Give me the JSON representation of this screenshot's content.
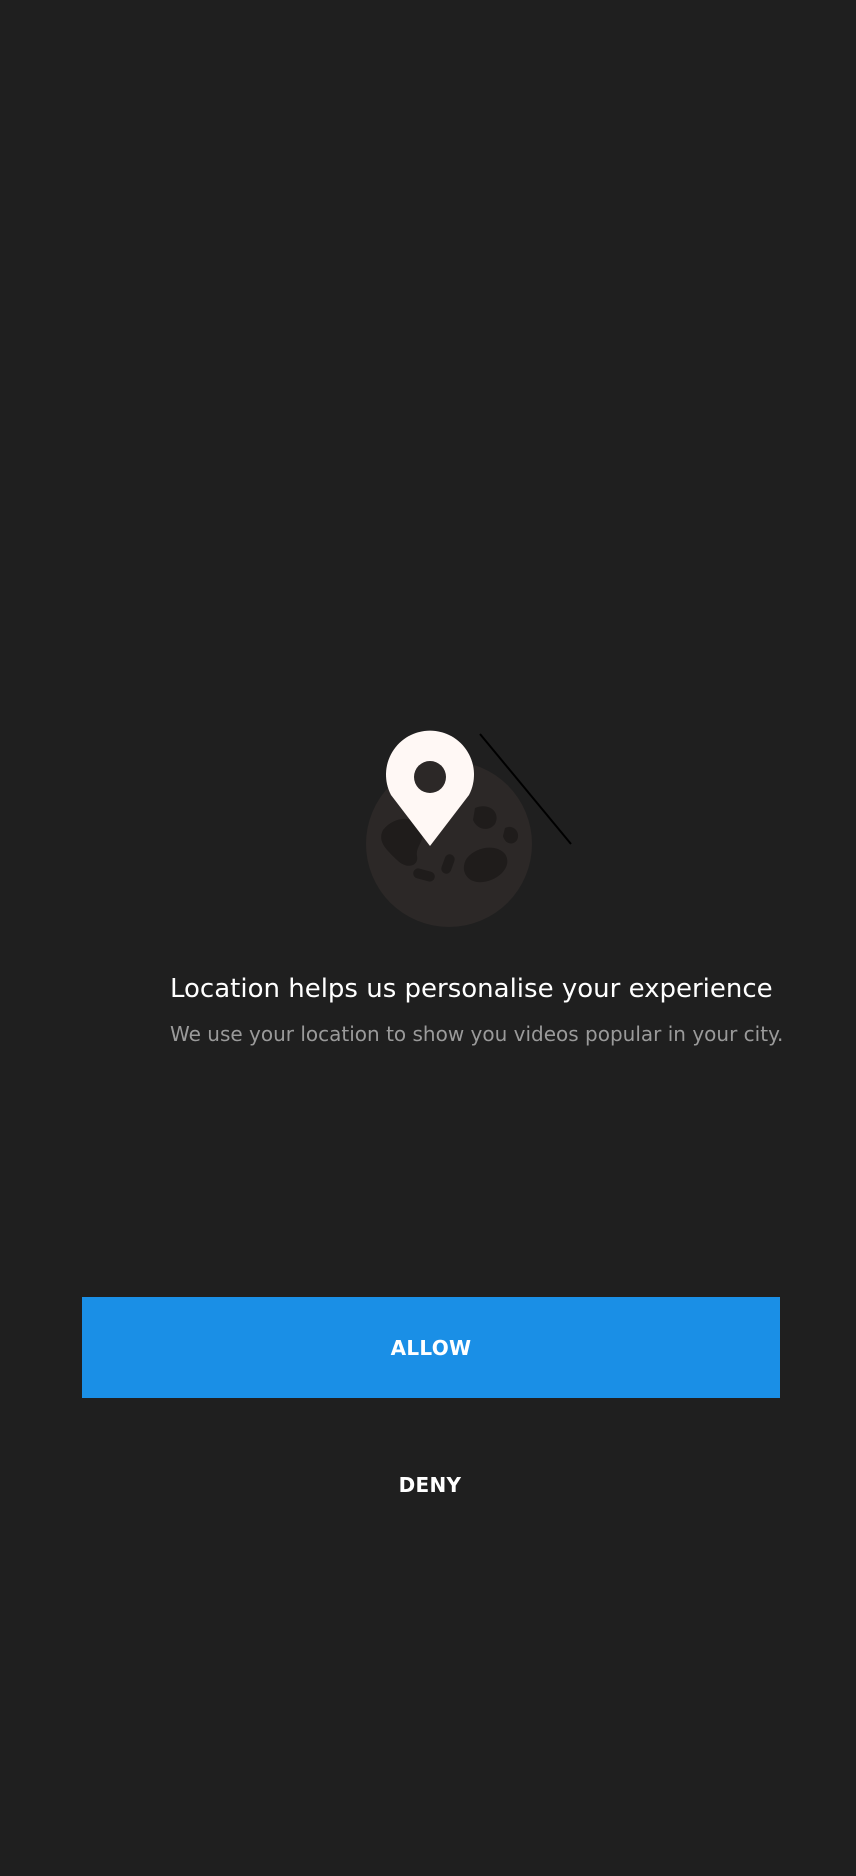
{
  "permission": {
    "title": "Location helps us personalise your experience",
    "subtitle": "We use your location to show you videos popular in your city.",
    "allow_label": "ALLOW",
    "deny_label": "DENY"
  },
  "illustration": {
    "icons": [
      "globe-icon",
      "location-pin-icon"
    ]
  },
  "colors": {
    "background": "#1f1f1f",
    "accent": "#1a8fe6",
    "title_text": "#ffffff",
    "subtitle_text": "#9a9a9a",
    "globe": "#2c2827",
    "pin": "#fff8f5"
  }
}
